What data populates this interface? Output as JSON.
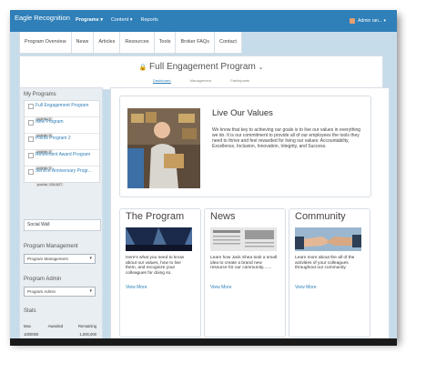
{
  "topbar": {
    "brand": "Eagle Recognition",
    "nav": [
      "Programs ▾",
      "Content ▾",
      "Reports"
    ],
    "user": "Admin ran... ▾"
  },
  "tabs": [
    "Program Overview",
    "News",
    "Articles",
    "Resources",
    "Tools",
    "Broker FAQs",
    "Contact"
  ],
  "program_header": {
    "title": "Full Engagement Program",
    "subtabs": [
      "Dashboard",
      "Management",
      "Participants"
    ]
  },
  "sidebar": {
    "my_programs_label": "My Programs",
    "programs": [
      {
        "name": "Full Engagement Program",
        "points": "points: 0"
      },
      {
        "name": "New Program",
        "points": "points: 0"
      },
      {
        "name": "Points Program 2",
        "points": "points: 0"
      },
      {
        "name": "Retirement Award Program",
        "points": "points: 0"
      },
      {
        "name": "Service Anniversary Progr...",
        "points": "points: 136,627"
      }
    ],
    "social_wall": "Social Wall",
    "mgmt_label": "Program Management",
    "mgmt_select": "Program Management",
    "admin_label": "Program Admin",
    "admin_select": "Program Admin",
    "stats_label": "Stats",
    "stats_headers": [
      "Max",
      "Awarded",
      "Remaining"
    ],
    "stats_values": [
      "1000000",
      "",
      "1,000,000"
    ]
  },
  "hero": {
    "title": "Live Our Values",
    "text": "We know that key to achieving our goals is to live our values in everything we do. It is our commitment to provide all of our employees the tools they need to thrive and feel rewarded for living our values: Accountability, Excellence, Inclusion, Innovation, Integrity, and Success."
  },
  "cards": [
    {
      "title": "The Program",
      "text": "Here's what you need to know about our values, how to live them, and recognize your colleagues for doing so.",
      "link": "View More"
    },
    {
      "title": "News",
      "text": "Learn how Jack Shea took a small idea to create a brand new resource for our community.......",
      "link": "View More"
    },
    {
      "title": "Community",
      "text": "Learn more about the all of the activities of your colleagues throughout our community.",
      "link": "View More"
    }
  ],
  "colors": {
    "accent": "#2f7fb8",
    "frame_bg": "#c7dcea"
  }
}
